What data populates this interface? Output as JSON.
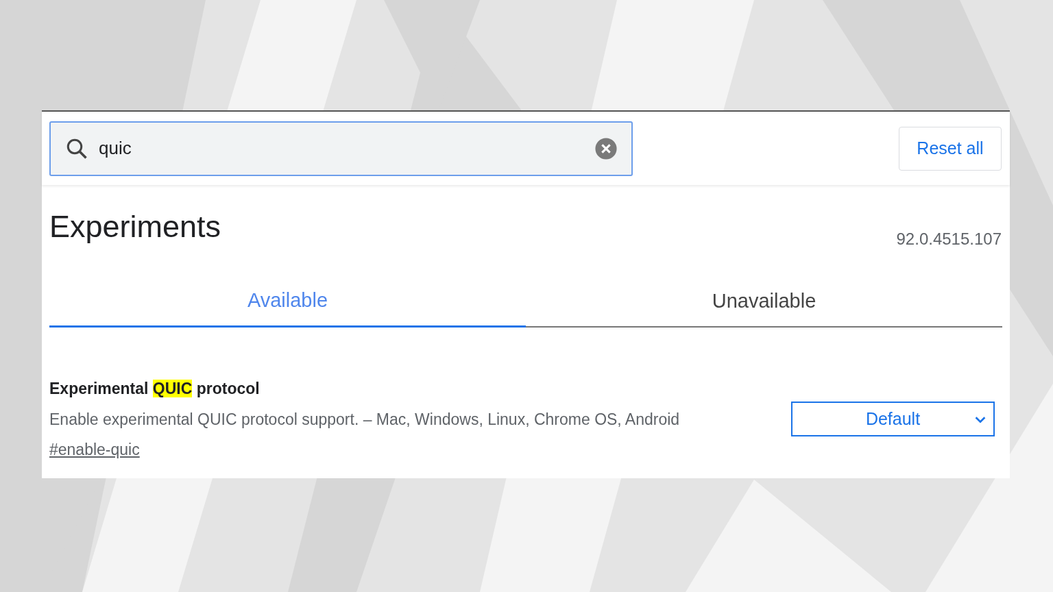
{
  "search": {
    "value": "quic"
  },
  "reset_button": "Reset all",
  "heading": "Experiments",
  "version": "92.0.4515.107",
  "tabs": [
    {
      "label": "Available",
      "selected": true
    },
    {
      "label": "Unavailable",
      "selected": false
    }
  ],
  "flags": [
    {
      "title_parts": [
        {
          "text": "Experimental ",
          "highlighted": false
        },
        {
          "text": "QUIC",
          "highlighted": true
        },
        {
          "text": " protocol",
          "highlighted": false
        }
      ],
      "description": "Enable experimental QUIC protocol support. – Mac, Windows, Linux, Chrome OS, Android",
      "link": "#enable-quic",
      "value": "Default"
    }
  ]
}
